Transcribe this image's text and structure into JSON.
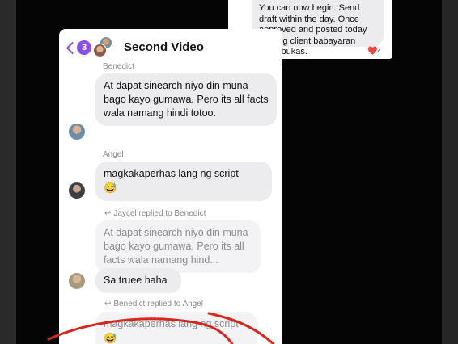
{
  "snippet": {
    "text": "You can now begin. Send draft within the day. Once approved and posted today sabi ng client babayaran agad bukas.",
    "reaction_emoji": "❤️",
    "reaction_count": "4"
  },
  "header": {
    "back_badge": "3",
    "title": "Second Video"
  },
  "messages": [
    {
      "sender": "Benedict",
      "text": "At dapat sinearch niyo din muna bago kayo gumawa. Pero its all facts wala namang hindi totoo."
    },
    {
      "sender": "Angel",
      "text": "magkakaperhas lang ng script",
      "emoji": "😅"
    },
    {
      "reply_label": "Jaycel replied to Benedict",
      "quoted": "At dapat sinearch niyo din muna bago kayo gumawa. Pero its all facts wala namang hind...",
      "text": "Sa truee haha"
    },
    {
      "reply_label": "Benedict replied to Angel",
      "quoted": "magkakaperhas lang ng script",
      "emoji": "😅"
    }
  ],
  "colors": {
    "accent": "#8b4fe6",
    "bubble": "#ececee",
    "annotation": "#d9251c"
  }
}
